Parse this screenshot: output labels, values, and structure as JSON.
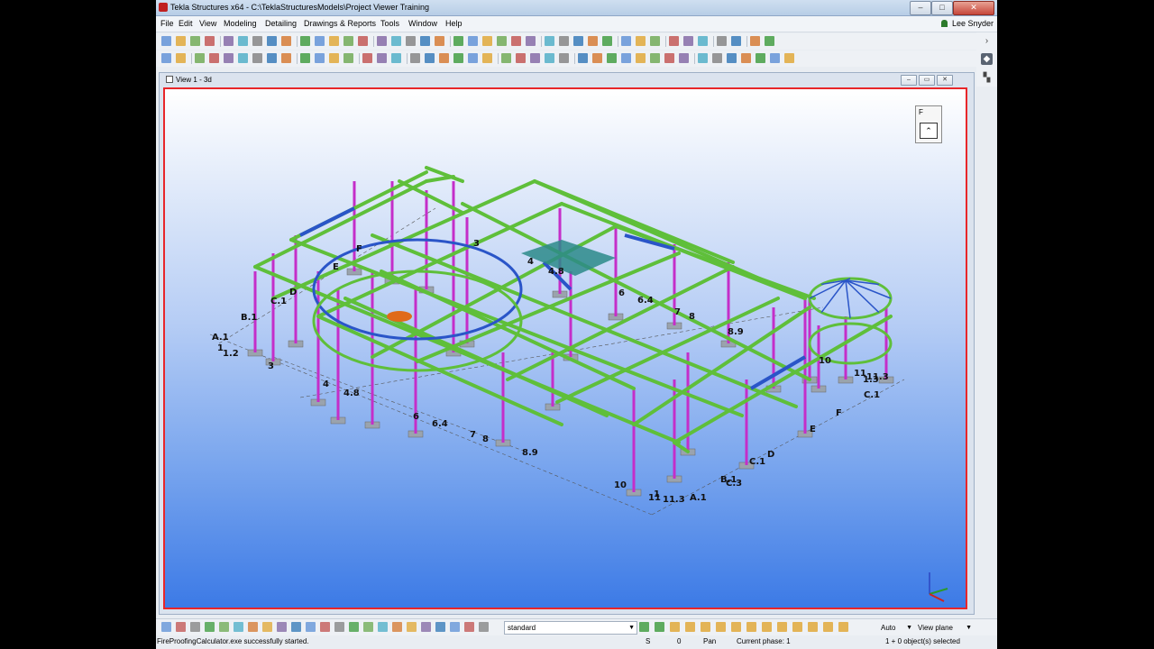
{
  "window": {
    "title": "Tekla Structures x64 - C:\\TeklaStructuresModels\\Project Viewer Training",
    "minimize": "–",
    "maximize": "□",
    "close": "✕"
  },
  "menubar": {
    "items": [
      "File",
      "Edit",
      "View",
      "Modeling",
      "Detailing",
      "Drawings & Reports",
      "Tools",
      "Window",
      "Help"
    ],
    "user": "Lee Snyder"
  },
  "view": {
    "title": "View 1 - 3d",
    "widget_label": "F",
    "widget_icon": "orientation-icon"
  },
  "grid_labels": [
    "A.1",
    "1",
    "1.2",
    "B.1",
    "C.1",
    "D",
    "E",
    "F",
    "3",
    "4",
    "4.8",
    "6",
    "6.4",
    "7",
    "8",
    "8.9",
    "10",
    "11",
    "11.3",
    "C.3",
    "A.1",
    "1",
    "1.3",
    "B.1",
    "C.1",
    "D",
    "E",
    "F",
    "3",
    "4",
    "4.8",
    "6",
    "6.4",
    "7",
    "8",
    "8.9",
    "10",
    "11",
    "11.3",
    "C.1"
  ],
  "bottombar": {
    "view_setting": "standard",
    "snap_mode": "Auto",
    "plane": "View plane"
  },
  "status": {
    "message": "FireProofingCalculator.exe successfully started.",
    "s_label": "S",
    "count": "0",
    "mode": "Pan",
    "phase": "Current phase: 1",
    "selection": "1 + 0 object(s) selected"
  },
  "colors": {
    "beam": "#5fbf3a",
    "column": "#c42ec9",
    "brace": "#2a55c8",
    "view_border": "#e8262a"
  }
}
